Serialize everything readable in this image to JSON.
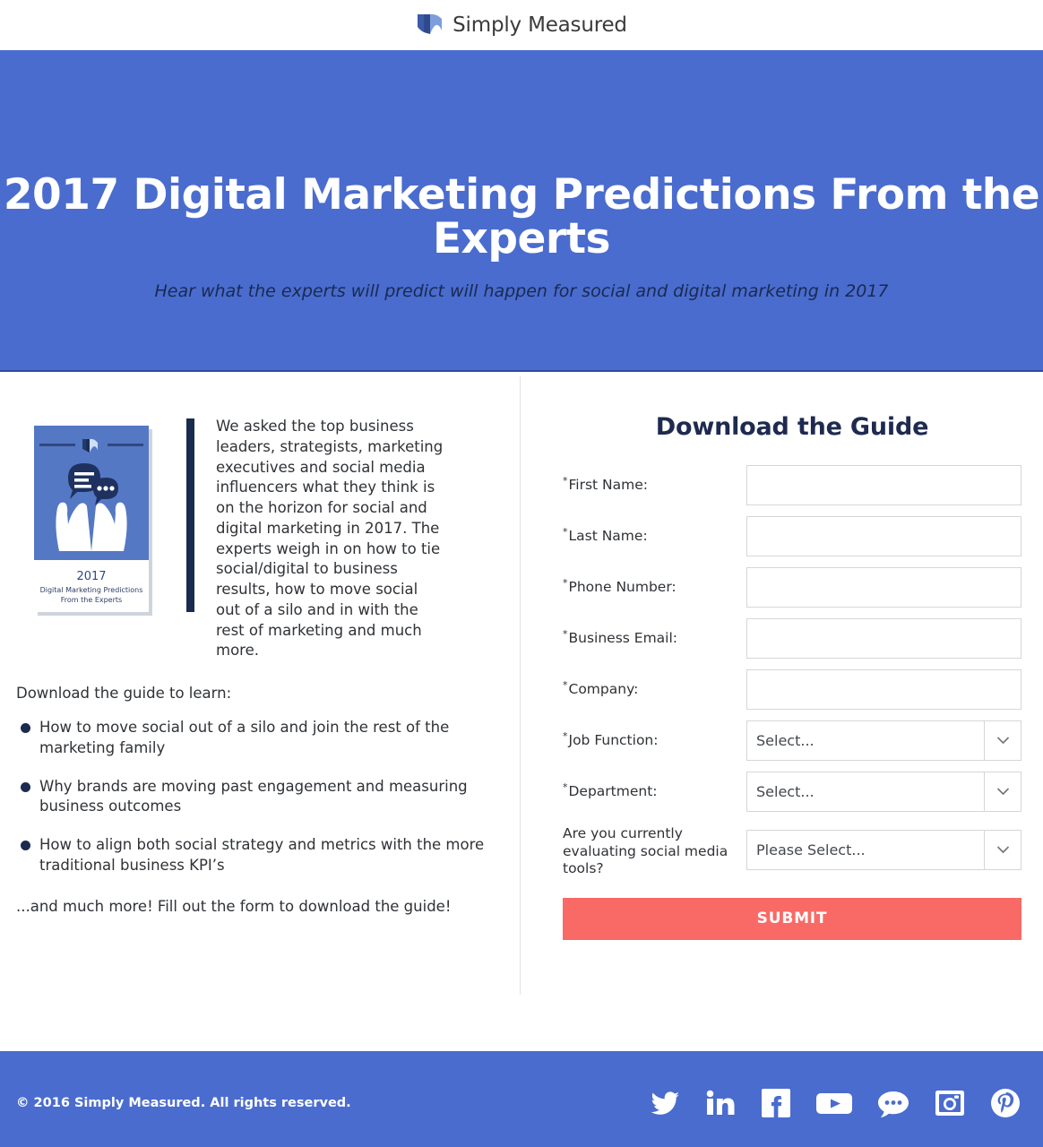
{
  "brand": {
    "logo_text": "Simply Measured",
    "logo_icon": "simply-measured-mark",
    "hero_blue": "#4a6cce",
    "navy": "#1e2a4f",
    "coral": "#f96a66"
  },
  "hero": {
    "title": "2017 Digital Marketing Predictions From the Experts",
    "subtitle": "Hear what the experts will predict will happen for social and digital marketing in 2017"
  },
  "ebook": {
    "cover_icon": "hands-holding-speech-bubbles",
    "year": "2017",
    "line1": "Digital Marketing Predictions",
    "line2": "From the Experts"
  },
  "intro": {
    "paragraph": "We asked the top business leaders, strategists, marketing executives and social media influencers what they think is on the horizon for social and digital marketing in 2017. The experts weigh in on how to tie social/digital to business results, how to move social out of a silo and in with the rest of marketing and much more."
  },
  "learn": {
    "lead": "Download the guide to learn:",
    "bullets": [
      "How to move social out of a silo and join the rest of the marketing family",
      "Why brands are moving past engagement and measuring business outcomes",
      "How to align both social strategy and metrics with the more traditional business KPI’s"
    ],
    "closing": "...and much more! Fill out the form to download the guide!"
  },
  "form": {
    "title": "Download the Guide",
    "required_marker": "*",
    "fields": [
      {
        "label": "First Name:",
        "required": true,
        "type": "text",
        "value": ""
      },
      {
        "label": "Last Name:",
        "required": true,
        "type": "text",
        "value": ""
      },
      {
        "label": "Phone Number:",
        "required": true,
        "type": "text",
        "value": ""
      },
      {
        "label": "Business Email:",
        "required": true,
        "type": "text",
        "value": ""
      },
      {
        "label": "Company:",
        "required": true,
        "type": "text",
        "value": ""
      },
      {
        "label": "Job Function:",
        "required": true,
        "type": "select",
        "value": "Select..."
      },
      {
        "label": "Department:",
        "required": true,
        "type": "select",
        "value": "Select..."
      },
      {
        "label": "Are you currently evaluating social media tools?",
        "required": false,
        "type": "select",
        "value": "Please Select..."
      }
    ],
    "submit_label": "SUBMIT",
    "dropdown_icon": "chevron-down-icon"
  },
  "footer": {
    "copyright": "© 2016 Simply Measured. All rights reserved.",
    "social": [
      {
        "name": "twitter-icon",
        "label": "Twitter"
      },
      {
        "name": "linkedin-icon",
        "label": "LinkedIn"
      },
      {
        "name": "facebook-icon",
        "label": "Facebook"
      },
      {
        "name": "youtube-icon",
        "label": "YouTube"
      },
      {
        "name": "blog-comment-icon",
        "label": "Blog"
      },
      {
        "name": "instagram-icon",
        "label": "Instagram"
      },
      {
        "name": "pinterest-icon",
        "label": "Pinterest"
      }
    ]
  }
}
